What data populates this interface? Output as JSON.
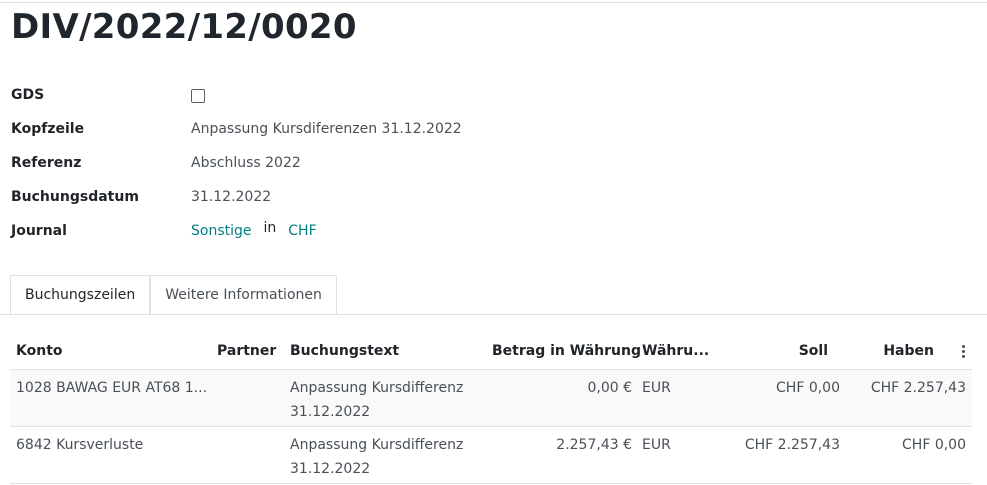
{
  "title": "DIV/2022/12/0020",
  "form": {
    "gds_label": "GDS",
    "kopfzeile_label": "Kopfzeile",
    "kopfzeile_value": "Anpassung Kursdiferenzen 31.12.2022",
    "referenz_label": "Referenz",
    "referenz_value": "Abschluss 2022",
    "buchungsdatum_label": "Buchungsdatum",
    "buchungsdatum_value": "31.12.2022",
    "journal_label": "Journal",
    "journal_name": "Sonstige",
    "journal_in": "in",
    "journal_currency": "CHF"
  },
  "tabs": [
    {
      "label": "Buchungszeilen"
    },
    {
      "label": "Weitere Informationen"
    }
  ],
  "table": {
    "headers": {
      "konto": "Konto",
      "partner": "Partner",
      "buchungstext": "Buchungstext",
      "betrag": "Betrag in Währung",
      "waehrung": "Währu...",
      "soll": "Soll",
      "haben": "Haben"
    },
    "rows": [
      {
        "konto": "1028 BAWAG EUR AT68 1...",
        "partner": "",
        "text1": "Anpassung Kursdifferenz",
        "text2": "31.12.2022",
        "betrag": "0,00 €",
        "waehrung": "EUR",
        "soll": "CHF 0,00",
        "haben": "CHF 2.257,43"
      },
      {
        "konto": "6842 Kursverluste",
        "partner": "",
        "text1": "Anpassung Kursdifferenz",
        "text2": "31.12.2022",
        "betrag": "2.257,43 €",
        "waehrung": "EUR",
        "soll": "CHF 2.257,43",
        "haben": "CHF 0,00"
      }
    ]
  },
  "colors": {
    "link": "#017e84"
  }
}
